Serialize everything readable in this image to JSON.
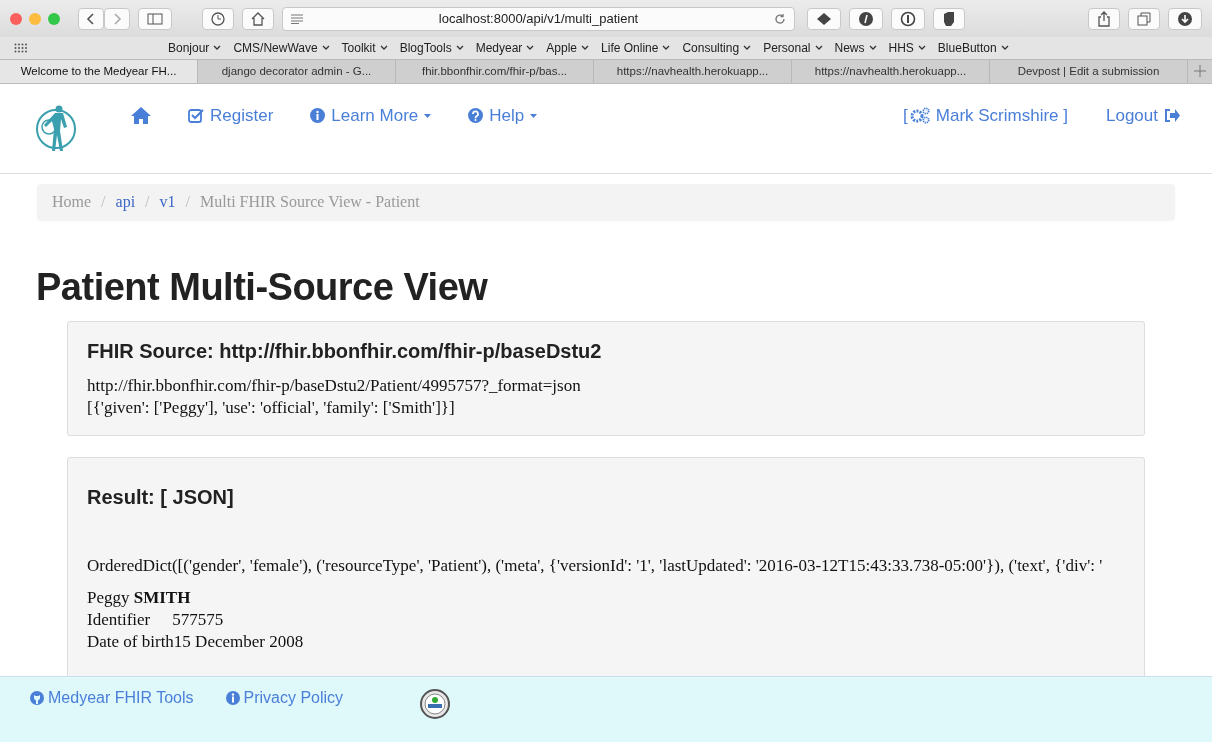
{
  "browser": {
    "address": "localhost:8000/api/v1/multi_patient",
    "bookmarks": [
      "Bonjour",
      "CMS/NewWave",
      "Toolkit",
      "BlogTools",
      "Medyear",
      "Apple",
      "Life Online",
      "Consulting",
      "Personal",
      "News",
      "HHS",
      "BlueButton"
    ],
    "tabs": [
      {
        "label": "Welcome to the Medyear FH...",
        "selected": true
      },
      {
        "label": "django decorator admin - G...",
        "selected": false
      },
      {
        "label": "fhir.bbonfhir.com/fhir-p/bas...",
        "selected": false
      },
      {
        "label": "https://navhealth.herokuapp...",
        "selected": false
      },
      {
        "label": "https://navhealth.herokuapp...",
        "selected": false
      },
      {
        "label": "Devpost | Edit a submission",
        "selected": false
      }
    ]
  },
  "navbar": {
    "items": [
      {
        "label": "Register",
        "kind": "register"
      },
      {
        "label": "Learn More",
        "kind": "info"
      },
      {
        "label": "Help",
        "kind": "help"
      }
    ],
    "user": "Mark Scrimshire ]",
    "user_prefix": "[",
    "logout": "Logout"
  },
  "breadcrumb_separator": "/",
  "breadcrumb": [
    {
      "label": "Home",
      "link": false
    },
    {
      "label": "api",
      "link": true
    },
    {
      "label": "v1",
      "link": true
    },
    {
      "label": "Multi FHIR Source View - Patient",
      "link": false
    }
  ],
  "heading": "Patient Multi-Source View",
  "source_panel": {
    "title": "FHIR Source: http://fhir.bbonfhir.com/fhir-p/baseDstu2",
    "url": "http://fhir.bbonfhir.com/fhir-p/baseDstu2/Patient/4995757?_format=json",
    "name": "[{'given': ['Peggy'], 'use': 'official', 'family': ['Smith']}]"
  },
  "result_panel": {
    "title": "Result: [ JSON]",
    "dict": "OrderedDict([('gender', 'female'), ('resourceType', 'Patient'), ('meta', {'versionId': '1', 'lastUpdated': '2016-03-12T15:43:33.738-05:00'}), ('text', {'div': '",
    "patient": "Peggy **SMITH**",
    "fields": [
      {
        "label": "Identifier",
        "value": "577575"
      },
      {
        "label": "Date of birth",
        "value": "15 December 2008"
      }
    ]
  },
  "footer": {
    "links": [
      {
        "label": "Medyear FHIR Tools",
        "kind": "github"
      },
      {
        "label": "Privacy Policy",
        "kind": "info"
      }
    ]
  }
}
